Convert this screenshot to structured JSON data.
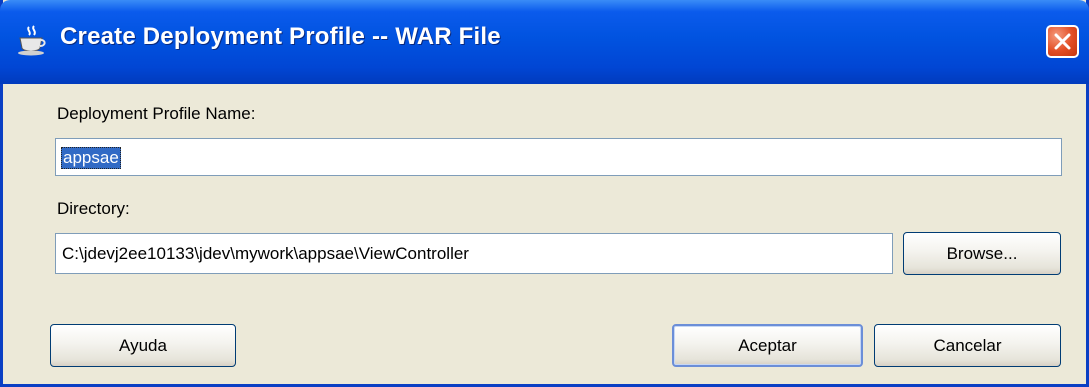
{
  "dialog": {
    "title": "Create Deployment Profile -- WAR File",
    "title_icon": "java-cup-icon",
    "close_icon": "close-icon"
  },
  "form": {
    "profile_name_label": "Deployment Profile Name:",
    "profile_name_value": "appsae",
    "directory_label": "Directory:",
    "directory_value": "C:\\jdevj2ee10133\\jdev\\mywork\\appsae\\ViewController",
    "browse_label": "Browse..."
  },
  "buttons": {
    "help_label": "Ayuda",
    "ok_label": "Aceptar",
    "cancel_label": "Cancelar"
  },
  "colors": {
    "titlebar": "#0153e0",
    "dialog_background": "#ece9d8",
    "selection": "#316ac5",
    "close_button": "#e24d24"
  }
}
